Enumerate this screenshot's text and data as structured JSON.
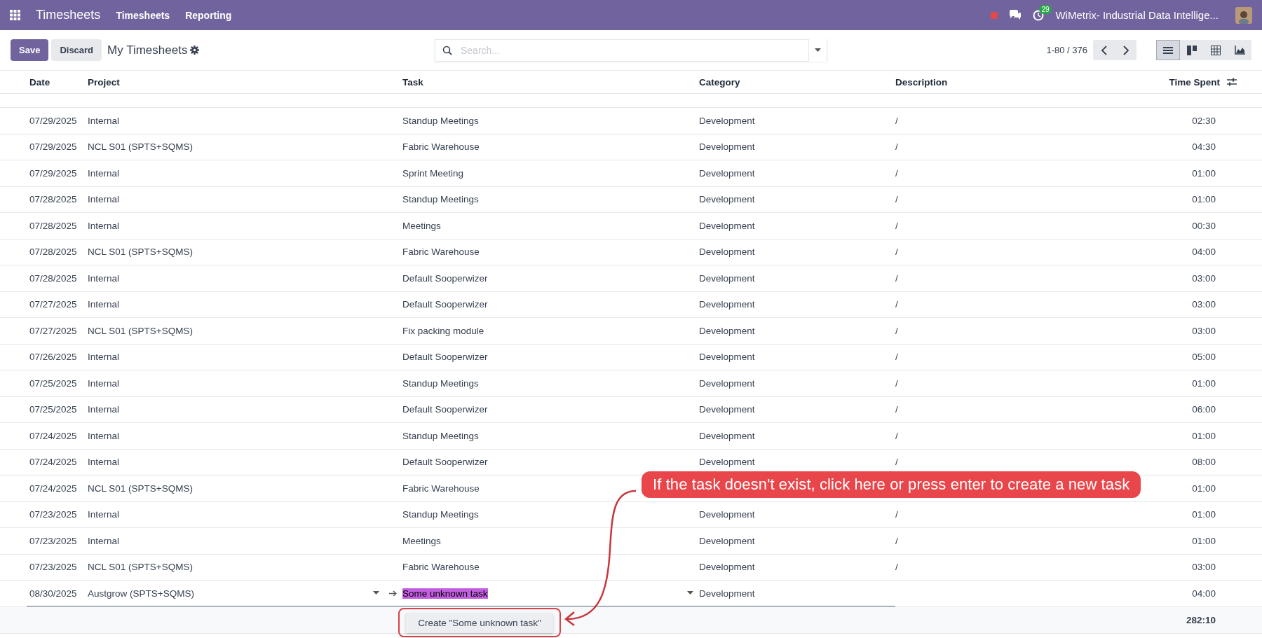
{
  "navbar": {
    "app_name": "Timesheets",
    "menu": [
      "Timesheets",
      "Reporting"
    ],
    "activity_count": "29",
    "company": "WiMetrix- Industrial Data Intellige..."
  },
  "control_panel": {
    "save": "Save",
    "discard": "Discard",
    "title": "My Timesheets",
    "search_placeholder": "Search...",
    "pager": "1-80 / 376",
    "views": [
      {
        "kind": "list",
        "selected": true
      },
      {
        "kind": "kanban",
        "selected": false
      },
      {
        "kind": "pivot",
        "selected": false
      },
      {
        "kind": "graph",
        "selected": false
      }
    ]
  },
  "table": {
    "columns": [
      "Date",
      "Project",
      "Task",
      "Category",
      "Description",
      "Time Spent"
    ],
    "rows": [
      {
        "date": "07/29/2025",
        "project": "Internal",
        "task": "Standup Meetings",
        "category": "Development",
        "description": "/",
        "time": "02:30"
      },
      {
        "date": "07/29/2025",
        "project": "NCL S01 (SPTS+SQMS)",
        "task": "Fabric Warehouse",
        "category": "Development",
        "description": "/",
        "time": "04:30"
      },
      {
        "date": "07/29/2025",
        "project": "Internal",
        "task": "Sprint Meeting",
        "category": "Development",
        "description": "/",
        "time": "01:00"
      },
      {
        "date": "07/28/2025",
        "project": "Internal",
        "task": "Standup Meetings",
        "category": "Development",
        "description": "/",
        "time": "01:00"
      },
      {
        "date": "07/28/2025",
        "project": "Internal",
        "task": "Meetings",
        "category": "Development",
        "description": "/",
        "time": "00:30"
      },
      {
        "date": "07/28/2025",
        "project": "NCL S01 (SPTS+SQMS)",
        "task": "Fabric Warehouse",
        "category": "Development",
        "description": "/",
        "time": "04:00"
      },
      {
        "date": "07/28/2025",
        "project": "Internal",
        "task": "Default Sooperwizer",
        "category": "Development",
        "description": "/",
        "time": "03:00"
      },
      {
        "date": "07/27/2025",
        "project": "Internal",
        "task": "Default Sooperwizer",
        "category": "Development",
        "description": "/",
        "time": "03:00"
      },
      {
        "date": "07/27/2025",
        "project": "NCL S01 (SPTS+SQMS)",
        "task": "Fix packing module",
        "category": "Development",
        "description": "/",
        "time": "03:00"
      },
      {
        "date": "07/26/2025",
        "project": "Internal",
        "task": "Default Sooperwizer",
        "category": "Development",
        "description": "/",
        "time": "05:00"
      },
      {
        "date": "07/25/2025",
        "project": "Internal",
        "task": "Standup Meetings",
        "category": "Development",
        "description": "/",
        "time": "01:00"
      },
      {
        "date": "07/25/2025",
        "project": "Internal",
        "task": "Default Sooperwizer",
        "category": "Development",
        "description": "/",
        "time": "06:00"
      },
      {
        "date": "07/24/2025",
        "project": "Internal",
        "task": "Standup Meetings",
        "category": "Development",
        "description": "/",
        "time": "01:00"
      },
      {
        "date": "07/24/2025",
        "project": "Internal",
        "task": "Default Sooperwizer",
        "category": "Development",
        "description": "/",
        "time": "08:00"
      },
      {
        "date": "07/24/2025",
        "project": "NCL S01 (SPTS+SQMS)",
        "task": "Fabric Warehouse",
        "time": "01:00"
      },
      {
        "date": "07/23/2025",
        "project": "Internal",
        "task": "Standup Meetings",
        "category": "Development",
        "description": "/",
        "time": "01:00"
      },
      {
        "date": "07/23/2025",
        "project": "Internal",
        "task": "Meetings",
        "category": "Development",
        "description": "/",
        "time": "01:00"
      },
      {
        "date": "07/23/2025",
        "project": "NCL S01 (SPTS+SQMS)",
        "task": "Fabric Warehouse",
        "category": "Development",
        "description": "/",
        "time": "03:00"
      }
    ],
    "editing_row": {
      "date": "08/30/2025",
      "project": "Austgrow (SPTS+SQMS)",
      "task": "Some unknown task",
      "category": "Development",
      "time": "04:00"
    },
    "autocomplete": {
      "option": "Create \"Some unknown task\""
    },
    "total": "282:10"
  },
  "annotation": {
    "text": "If the task doesn't exist, click here or press enter to create a new task"
  }
}
